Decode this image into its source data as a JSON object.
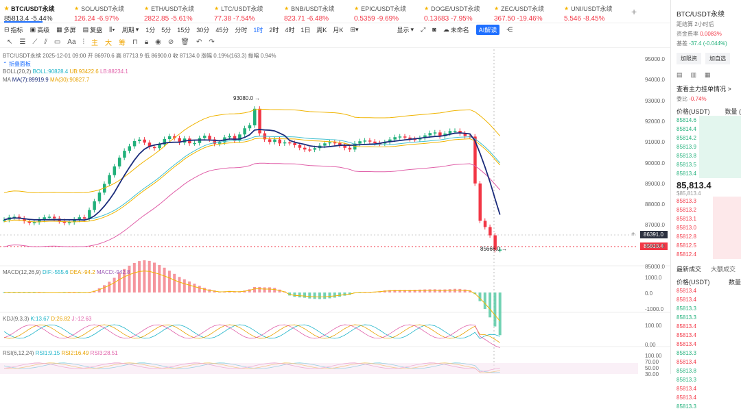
{
  "tickers": [
    {
      "name": "BTC/USDT永续",
      "price": "85813.4",
      "change": "-5.44%",
      "active": true
    },
    {
      "name": "SOL/USDT永续",
      "price": "126.24",
      "change": "-6.97%"
    },
    {
      "name": "ETH/USDT永续",
      "price": "2822.85",
      "change": "-5.61%"
    },
    {
      "name": "LTC/USDT永续",
      "price": "77.38",
      "change": "-7.54%"
    },
    {
      "name": "BNB/USDT永续",
      "price": "823.71",
      "change": "-6.48%"
    },
    {
      "name": "EPIC/USDT永续",
      "price": "0.5359",
      "change": "-9.69%"
    },
    {
      "name": "DOGE/USDT永续",
      "price": "0.13683",
      "change": "-7.95%"
    },
    {
      "name": "ZEC/USDT永续",
      "price": "367.50",
      "change": "-19.46%"
    },
    {
      "name": "UNI/USDT永续",
      "price": "5.546",
      "change": "-8.45%"
    }
  ],
  "add_tab": "+",
  "toolbar": {
    "indicator": "指标",
    "advanced": "高级",
    "multi": "多屏",
    "replay": "复盘",
    "period_label": "周期",
    "periods": [
      "1分",
      "5分",
      "15分",
      "30分",
      "45分",
      "分时",
      "1时",
      "2时",
      "4时",
      "1日",
      "周K",
      "月K"
    ],
    "selected_period": "1时",
    "display": "显示",
    "unnamed": "未命名",
    "ai": "AI解读"
  },
  "drawbar": {
    "zh1": "主",
    "zh2": "大",
    "zh3": "筹"
  },
  "chart": {
    "ohlc": "BTC/USDT永续 2025-12-01 09:00 开 86970.6 高 87713.9 低 86900.0 收 87134.0 涨幅 0.19%(163.3) 振幅 0.94%",
    "fold": "折叠面板",
    "boll_label": "BOLL(20,2)",
    "boll": "BOLL:90828.4",
    "ub": "UB:93422.6",
    "lb": "LB:88234.1",
    "ma_label": "MA",
    "ma7": "MA(7):89919.9",
    "ma30": "MA(30):90827.7",
    "hi_marker": "93080.0",
    "lo_marker": "85666.0",
    "crosshair_price": "86391.0",
    "last_price": "85813.4",
    "macd_label": "MACD(12,26,9)",
    "dif": "DIF:-555.6",
    "dea": "DEA:-94.2",
    "macd": "MACD:-942.8",
    "kdj_label": "KDJ(9,3,3)",
    "k": "K:13.67",
    "d": "D:26.82",
    "j": "J:-12.63",
    "rsi_label": "RSI(6,12,24)",
    "rsi1": "RSI1:9.15",
    "rsi2": "RSI2:16.49",
    "rsi3": "RSI3:28.51",
    "yaxis": [
      "95000.0",
      "94000.0",
      "93000.0",
      "92000.0",
      "91000.0",
      "90000.0",
      "89000.0",
      "88000.0",
      "87000.0",
      "86000.0",
      "85000.0"
    ],
    "macd_axis": [
      "1000.0",
      "0.0",
      "-1000.0"
    ],
    "kdj_axis": [
      "100.00",
      "0.00"
    ],
    "rsi_axis": [
      "100.00",
      "70.00",
      "50.00",
      "30.00"
    ]
  },
  "colors": {
    "up": "#21b07a",
    "down": "#f23645",
    "ma7": "#1a2b7a",
    "ub": "#f0b400",
    "lb": "#e05fa8",
    "boll": "#42c0d0"
  },
  "panel": {
    "title": "BTC/USDT永续",
    "settle_label": "距结算",
    "settle": "2小时后",
    "fund_label": "资金费率",
    "fund": "0.0083%",
    "basis_label": "基差",
    "basis": "-37.4 (-0.044%)",
    "btn_add": "加限资",
    "btn_fav": "加自选",
    "main_order": "查看主力挂单情况 >",
    "ratio_label": "委比",
    "ratio": "-0.74%",
    "ob_price": "价格(USDT)",
    "ob_qty": "数量 (",
    "asks": [
      "85814.6",
      "85814.4",
      "85814.2",
      "85813.9",
      "85813.8",
      "85813.5",
      "85813.4"
    ],
    "last": "85,813.4",
    "mark": "$85,813.4",
    "bids": [
      "85813.3",
      "85813.2",
      "85813.1",
      "85813.0",
      "85812.8",
      "85812.5",
      "85812.4"
    ],
    "tab_latest": "最新成交",
    "tab_big": "大额成交",
    "tr_price": "价格(USDT)",
    "tr_qty": "数量",
    "trades": [
      {
        "p": "85813.4",
        "s": "d"
      },
      {
        "p": "85813.4",
        "s": "d"
      },
      {
        "p": "85813.3",
        "s": "u"
      },
      {
        "p": "85813.3",
        "s": "u"
      },
      {
        "p": "85813.4",
        "s": "d"
      },
      {
        "p": "85813.4",
        "s": "d"
      },
      {
        "p": "85813.4",
        "s": "d"
      },
      {
        "p": "85813.3",
        "s": "u"
      },
      {
        "p": "85813.4",
        "s": "d"
      },
      {
        "p": "85813.8",
        "s": "u"
      },
      {
        "p": "85813.3",
        "s": "u"
      },
      {
        "p": "85813.4",
        "s": "d"
      },
      {
        "p": "85813.4",
        "s": "d"
      },
      {
        "p": "85813.3",
        "s": "u"
      }
    ]
  }
}
